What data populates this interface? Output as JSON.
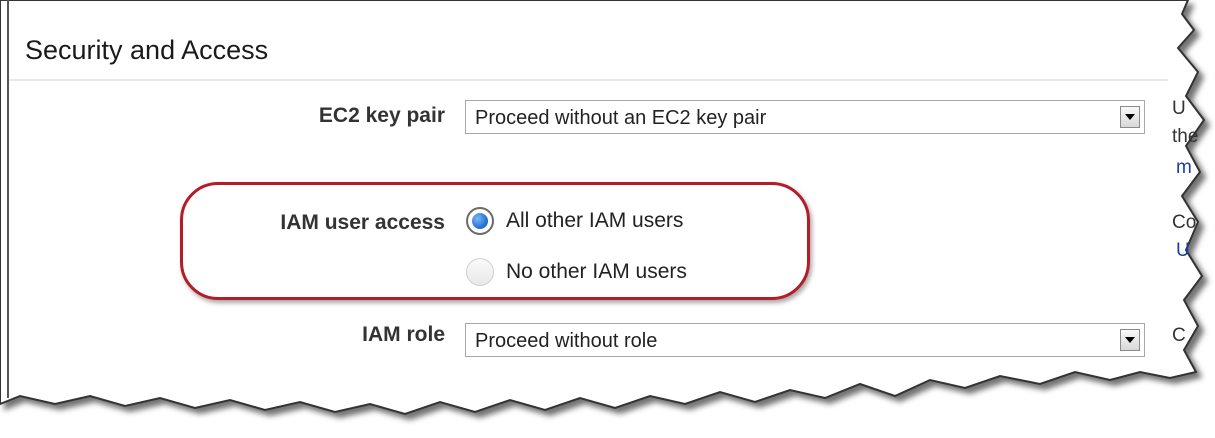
{
  "section": {
    "title": "Security and Access"
  },
  "fields": {
    "ec2_key_pair": {
      "label": "EC2 key pair",
      "value": "Proceed without an EC2 key pair"
    },
    "iam_user_access": {
      "label": "IAM user access",
      "options": [
        {
          "label": "All other IAM users",
          "selected": true
        },
        {
          "label": "No other IAM users",
          "selected": false
        }
      ]
    },
    "iam_role": {
      "label": "IAM role",
      "value": "Proceed without role"
    }
  },
  "side_text": {
    "line1": "U",
    "line2": "the",
    "line3": "m",
    "line4": "Co",
    "line5": "U",
    "line6": "C"
  },
  "colors": {
    "highlight": "#b31d27",
    "link": "#1a3fa0",
    "radio_selected": "#1c6bd1"
  }
}
